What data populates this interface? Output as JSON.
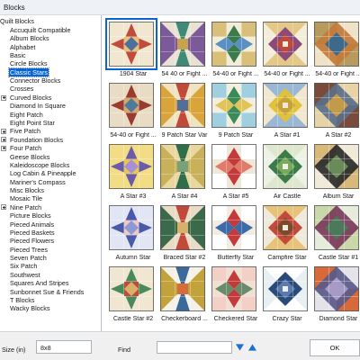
{
  "window": {
    "title": "Blocks"
  },
  "sidebar": {
    "root_label": "Quilt Blocks",
    "items": [
      {
        "label": "Accuquilt Compatible",
        "expandable": false,
        "selected": false
      },
      {
        "label": "Album Blocks",
        "expandable": false,
        "selected": false
      },
      {
        "label": "Alphabet",
        "expandable": false,
        "selected": false
      },
      {
        "label": "Basic",
        "expandable": false,
        "selected": false
      },
      {
        "label": "Circle Blocks",
        "expandable": false,
        "selected": false
      },
      {
        "label": "Classic Stars",
        "expandable": false,
        "selected": true
      },
      {
        "label": "Connector Blocks",
        "expandable": false,
        "selected": false
      },
      {
        "label": "Crosses",
        "expandable": false,
        "selected": false
      },
      {
        "label": "Curved Blocks",
        "expandable": true,
        "selected": false
      },
      {
        "label": "Diamond In Square",
        "expandable": false,
        "selected": false
      },
      {
        "label": "Eight Patch",
        "expandable": false,
        "selected": false
      },
      {
        "label": "Eight Point Star",
        "expandable": false,
        "selected": false
      },
      {
        "label": "Five Patch",
        "expandable": true,
        "selected": false
      },
      {
        "label": "Foundation Blocks",
        "expandable": true,
        "selected": false
      },
      {
        "label": "Four Patch",
        "expandable": true,
        "selected": false
      },
      {
        "label": "Geese Blocks",
        "expandable": false,
        "selected": false
      },
      {
        "label": "Kaleidoscope Blocks",
        "expandable": false,
        "selected": false
      },
      {
        "label": "Log Cabin & Pineapple",
        "expandable": false,
        "selected": false
      },
      {
        "label": "Mariner's Compass",
        "expandable": false,
        "selected": false
      },
      {
        "label": "Misc Blocks",
        "expandable": false,
        "selected": false
      },
      {
        "label": "Mosaic Tile",
        "expandable": false,
        "selected": false
      },
      {
        "label": "Nine Patch",
        "expandable": true,
        "selected": false
      },
      {
        "label": "Picture Blocks",
        "expandable": false,
        "selected": false
      },
      {
        "label": "Pieced Animals",
        "expandable": false,
        "selected": false
      },
      {
        "label": "Pieced Baskets",
        "expandable": false,
        "selected": false
      },
      {
        "label": "Pieced Flowers",
        "expandable": false,
        "selected": false
      },
      {
        "label": "Pieced Trees",
        "expandable": false,
        "selected": false
      },
      {
        "label": "Seven Patch",
        "expandable": false,
        "selected": false
      },
      {
        "label": "Six Patch",
        "expandable": false,
        "selected": false
      },
      {
        "label": "Southwest",
        "expandable": false,
        "selected": false
      },
      {
        "label": "Squares And Stripes",
        "expandable": false,
        "selected": false
      },
      {
        "label": "Sunbonnet Sue & Friends",
        "expandable": false,
        "selected": false
      },
      {
        "label": "T Blocks",
        "expandable": false,
        "selected": false
      },
      {
        "label": "Wacky Blocks",
        "expandable": false,
        "selected": false
      }
    ]
  },
  "blocks": [
    {
      "label": "1904 Star",
      "selected": true,
      "colors": {
        "bg": "#f1e6cf",
        "a": "#c24a3a",
        "b": "#4f6f9c",
        "c": "#e7c27a"
      }
    },
    {
      "label": "54 40 or Fight ...",
      "selected": false,
      "colors": {
        "bg": "#e8e2d3",
        "a": "#3d8a76",
        "b": "#7c5a9a",
        "c": "#c9a24e"
      }
    },
    {
      "label": "54-40 or Fight ...",
      "selected": false,
      "colors": {
        "bg": "#f2ecd8",
        "a": "#3a7a4b",
        "b": "#5a8fc4",
        "c": "#d8c07a"
      }
    },
    {
      "label": "54-40 or Fight ...",
      "selected": false,
      "colors": {
        "bg": "#f4edd9",
        "a": "#8a4a7a",
        "b": "#c24a3a",
        "c": "#e3c888"
      }
    },
    {
      "label": "54-40 or Fight ...",
      "selected": false,
      "colors": {
        "bg": "#efe2c6",
        "a": "#c27a3a",
        "b": "#3d6a8a",
        "c": "#b79a5e"
      }
    },
    {
      "label": "54-40 or Fight ...",
      "selected": false,
      "colors": {
        "bg": "#e9dcc4",
        "a": "#9b3a2e",
        "b": "#4f7a9c",
        "c": "#d1a96a"
      }
    },
    {
      "label": "9 Patch Star Var",
      "selected": false,
      "colors": {
        "bg": "#f0e3c2",
        "a": "#c24a3a",
        "b": "#d9a43a",
        "c": "#4f6f9c"
      }
    },
    {
      "label": "9 Patch Star",
      "selected": false,
      "colors": {
        "bg": "#f4eedf",
        "a": "#3a8a5a",
        "b": "#e0c45a",
        "c": "#a0cfe0"
      }
    },
    {
      "label": "A Star #1",
      "selected": false,
      "colors": {
        "bg": "#f2e8cf",
        "a": "#e0c23a",
        "b": "#c7a23a",
        "c": "#9ab8d6"
      }
    },
    {
      "label": "A Star #2",
      "selected": false,
      "colors": {
        "bg": "#e7d3a8",
        "a": "#5a6f8a",
        "b": "#c29a4a",
        "c": "#7a4a3a"
      }
    },
    {
      "label": "A Star #3",
      "selected": false,
      "colors": {
        "bg": "#f2dc86",
        "a": "#6a5aa8",
        "b": "#a98fd6",
        "c": "#e9c84a"
      }
    },
    {
      "label": "A Star #4",
      "selected": false,
      "colors": {
        "bg": "#e8d8a0",
        "a": "#2f6e4a",
        "b": "#c9b15a",
        "c": "#7aa07a"
      }
    },
    {
      "label": "A Star #5",
      "selected": false,
      "colors": {
        "bg": "#f0e7d8",
        "a": "#c23a3a",
        "b": "#e07a6a",
        "c": "#ffffff"
      }
    },
    {
      "label": "Air Castle",
      "selected": false,
      "colors": {
        "bg": "#eef2e6",
        "a": "#3c7a4a",
        "b": "#7aa95a",
        "c": "#dfe8cf"
      }
    },
    {
      "label": "Album Star",
      "selected": false,
      "colors": {
        "bg": "#f1ead9",
        "a": "#2a2a2a",
        "b": "#6a8a5a",
        "c": "#d8b97a"
      }
    },
    {
      "label": "Autumn Star",
      "selected": false,
      "colors": {
        "bg": "#e2e6f4",
        "a": "#4a5aa8",
        "b": "#8a9ad6",
        "c": "#f2c8c0"
      }
    },
    {
      "label": "Braced Star #2",
      "selected": false,
      "colors": {
        "bg": "#e9dcc7",
        "a": "#c24a3a",
        "b": "#3a6a4a",
        "c": "#d9b06a"
      }
    },
    {
      "label": "Butterfly Star",
      "selected": false,
      "colors": {
        "bg": "#f3ece2",
        "a": "#c23a3a",
        "b": "#3a6aa8",
        "c": "#ffffff"
      }
    },
    {
      "label": "Campfire Star",
      "selected": false,
      "colors": {
        "bg": "#efeadb",
        "a": "#c24a3a",
        "b": "#7a4a2a",
        "c": "#e7c27a"
      }
    },
    {
      "label": "Castle Star #1",
      "selected": false,
      "colors": {
        "bg": "#e6ecdc",
        "a": "#7a3a5a",
        "b": "#4a7a5a",
        "c": "#c8d8a8"
      }
    },
    {
      "label": "Castle Star #2",
      "selected": false,
      "colors": {
        "bg": "#f1e6d2",
        "a": "#4a8a5a",
        "b": "#d8b06a",
        "c": "#c24a3a"
      }
    },
    {
      "label": "Checkerboard ...",
      "selected": false,
      "colors": {
        "bg": "#f4f1e8",
        "a": "#3a6a9a",
        "b": "#c2a23a",
        "c": "#d96a3a"
      }
    },
    {
      "label": "Checkered Star",
      "selected": false,
      "colors": {
        "bg": "#efe0d6",
        "a": "#c23a3a",
        "b": "#6a8a6a",
        "c": "#f2d0c6"
      }
    },
    {
      "label": "Crazy Star",
      "selected": false,
      "colors": {
        "bg": "#e9f0f4",
        "a": "#2a4a7a",
        "b": "#5a7ab0",
        "c": "#ffffff"
      }
    },
    {
      "label": "Diamond Star",
      "selected": false,
      "colors": {
        "bg": "#e6e2ea",
        "a": "#5a5a8a",
        "b": "#a89ac6",
        "c": "#d86a3a"
      }
    }
  ],
  "bottombar": {
    "size_label": "Size (in)",
    "size_value": "8x8",
    "find_label": "Find",
    "find_value": "",
    "ok_label": "OK"
  }
}
